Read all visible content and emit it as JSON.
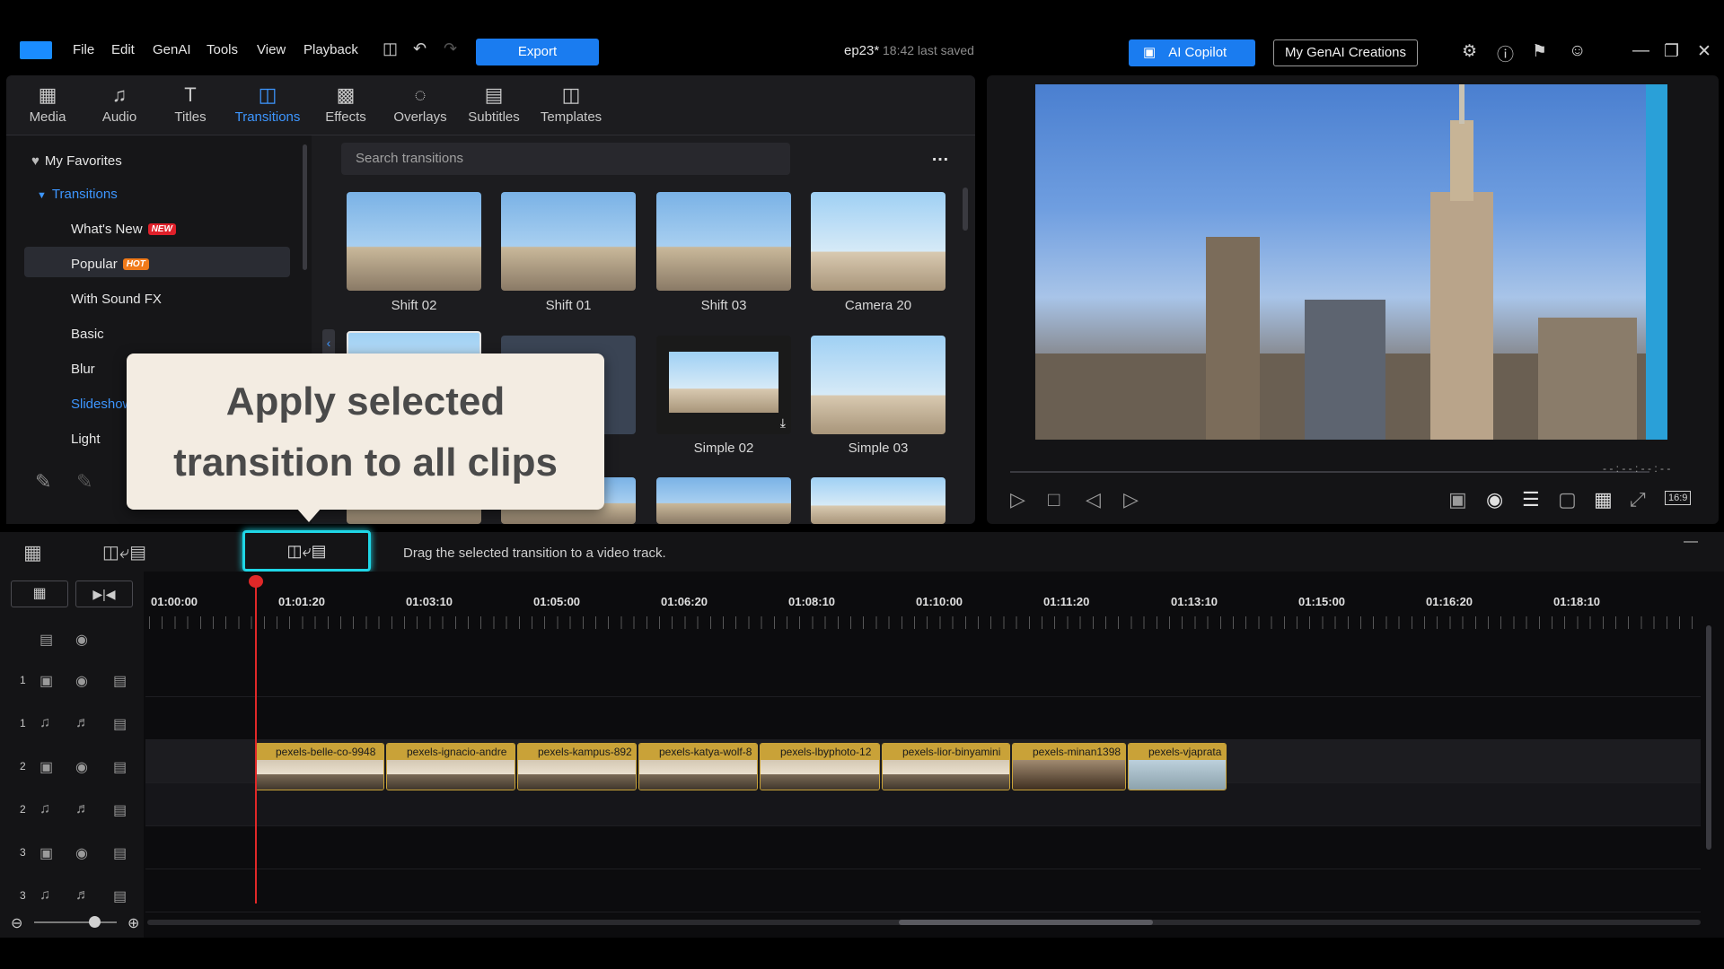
{
  "menubar": {
    "items": [
      "File",
      "Edit",
      "GenAI",
      "Tools",
      "View",
      "Playback"
    ],
    "export_label": "Export",
    "project_name": "ep23*",
    "project_saved": "18:42 last saved",
    "ai_copilot_label": "AI Copilot",
    "genai_creations_label": "My GenAI Creations"
  },
  "library": {
    "tabs": [
      {
        "label": "Media",
        "icon": "media-icon"
      },
      {
        "label": "Audio",
        "icon": "audio-icon"
      },
      {
        "label": "Titles",
        "icon": "titles-icon"
      },
      {
        "label": "Transitions",
        "icon": "transitions-icon",
        "active": true
      },
      {
        "label": "Effects",
        "icon": "effects-icon"
      },
      {
        "label": "Overlays",
        "icon": "overlays-icon"
      },
      {
        "label": "Subtitles",
        "icon": "subtitles-icon"
      },
      {
        "label": "Templates",
        "icon": "templates-icon"
      }
    ],
    "tree": {
      "favorites": "My Favorites",
      "root": "Transitions",
      "items": [
        "What's New",
        "Popular",
        "With Sound FX",
        "Basic",
        "Blur",
        "Slideshow",
        "Light"
      ],
      "badge_new": "NEW",
      "badge_hot": "HOT"
    },
    "search_placeholder": "Search transitions",
    "more_label": "…",
    "thumbnails": [
      "Shift 02",
      "Shift 01",
      "Shift 03",
      "Camera 20",
      "Simple 02",
      "Simple 03"
    ]
  },
  "tooltip": {
    "line1": "Apply selected",
    "line2": "transition to all clips"
  },
  "preview": {
    "timecode": "- - : - - : - - : - -",
    "aspect": "16:9"
  },
  "timeline": {
    "hint": "Drag the selected transition to a video track.",
    "ruler": [
      "01:00:00",
      "01:01:20",
      "01:03:10",
      "01:05:00",
      "01:06:20",
      "01:08:10",
      "01:10:00",
      "01:11:20",
      "01:13:10",
      "01:15:00",
      "01:16:20",
      "01:18:10"
    ],
    "tracks": [
      {
        "num": "1",
        "kind": "video"
      },
      {
        "num": "1",
        "kind": "audio"
      },
      {
        "num": "2",
        "kind": "video"
      },
      {
        "num": "2",
        "kind": "audio"
      },
      {
        "num": "3",
        "kind": "video"
      },
      {
        "num": "3",
        "kind": "audio"
      }
    ],
    "clips": [
      "pexels-belle-co-9948",
      "pexels-ignacio-andre",
      "pexels-kampus-892",
      "pexels-katya-wolf-8",
      "pexels-lbyphoto-12",
      "pexels-lior-binyamini",
      "pexels-minan1398",
      "pexels-vjaprata"
    ]
  }
}
